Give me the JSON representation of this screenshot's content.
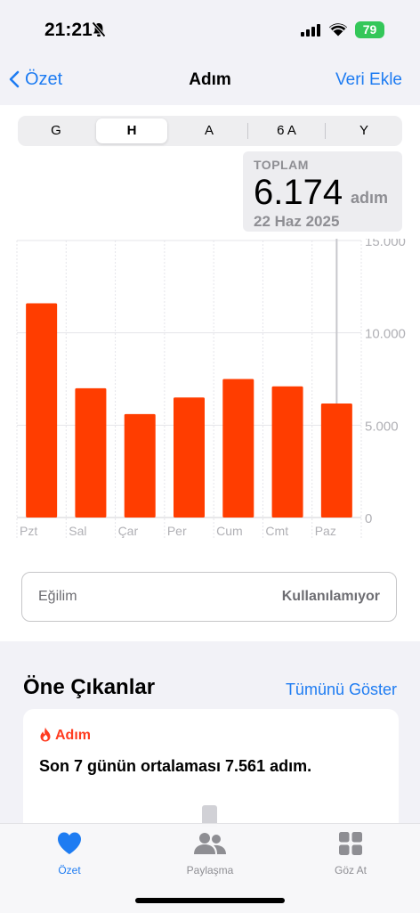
{
  "status": {
    "time": "21:21",
    "battery": "79"
  },
  "nav": {
    "back_label": "Özet",
    "title": "Adım",
    "action_label": "Veri Ekle"
  },
  "segments": [
    "G",
    "H",
    "A",
    "6 A",
    "Y"
  ],
  "selected_segment": "H",
  "tooltip": {
    "label": "TOPLAM",
    "value": "6.174",
    "unit": "adım",
    "date": "22 Haz 2025"
  },
  "chart_data": {
    "type": "bar",
    "categories": [
      "Pzt",
      "Sal",
      "Çar",
      "Per",
      "Cum",
      "Cmt",
      "Paz"
    ],
    "values": [
      11600,
      7000,
      5600,
      6500,
      7500,
      7100,
      6174
    ],
    "y_ticks": [
      "15.000",
      "10.000",
      "5.000",
      "0"
    ],
    "ylim": [
      0,
      15000
    ],
    "highlight_index": 6,
    "bar_color": "#ff3d00",
    "grid": true,
    "xlabel": "",
    "ylabel": ""
  },
  "trend": {
    "label": "Eğilim",
    "value": "Kullanılamıyor"
  },
  "highlights": {
    "title": "Öne Çıkanlar",
    "show_all": "Tümünü Göster",
    "card_label": "Adım",
    "card_text": "Son 7 günün ortalaması 7.561 adım."
  },
  "tabs": [
    {
      "label": "Özet",
      "icon": "heart-icon"
    },
    {
      "label": "Paylaşma",
      "icon": "people-icon"
    },
    {
      "label": "Göz At",
      "icon": "grid-icon"
    }
  ],
  "colors": {
    "accent": "#1e7cf2",
    "bars": "#ff3d00",
    "battery": "#34c759"
  }
}
